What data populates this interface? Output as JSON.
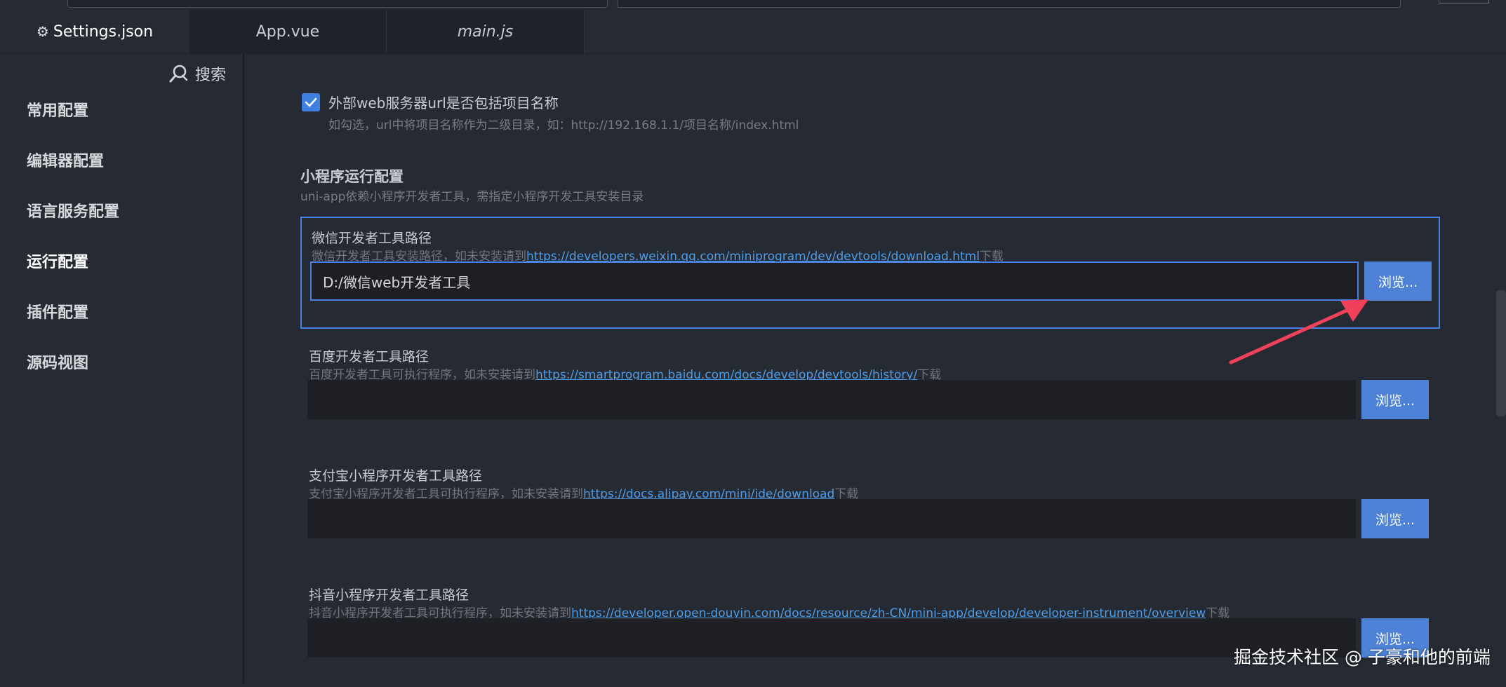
{
  "tabs": [
    {
      "label": "Settings.json",
      "icon": "gear-icon",
      "active": true
    },
    {
      "label": "App.vue",
      "active": false
    },
    {
      "label": "main.js",
      "active": false
    }
  ],
  "sidebar": {
    "search_label": "搜索",
    "items": [
      {
        "label": "常用配置"
      },
      {
        "label": "编辑器配置"
      },
      {
        "label": "语言服务配置"
      },
      {
        "label": "运行配置",
        "active": true
      },
      {
        "label": "插件配置"
      },
      {
        "label": "源码视图"
      }
    ]
  },
  "settings": {
    "checkbox": {
      "label": "外部web服务器url是否包括项目名称",
      "desc": "如勾选，url中将项目名称作为二级目录，如：http://192.168.1.1/项目名称/index.html",
      "checked": true
    },
    "section": {
      "title": "小程序运行配置",
      "desc": "uni-app依赖小程序开发者工具，需指定小程序开发工具安装目录"
    },
    "groups": [
      {
        "label": "微信开发者工具路径",
        "desc_prefix": "微信开发者工具安装路径，如未安装请到",
        "link": "https://developers.weixin.qq.com/miniprogram/dev/devtools/download.html",
        "desc_suffix": "下载",
        "value": "D:/微信web开发者工具",
        "browse": "浏览..."
      },
      {
        "label": "百度开发者工具路径",
        "desc_prefix": "百度开发者工具可执行程序，如未安装请到",
        "link": "https://smartprogram.baidu.com/docs/develop/devtools/history/",
        "desc_suffix": "下载",
        "value": "",
        "browse": "浏览..."
      },
      {
        "label": "支付宝小程序开发者工具路径",
        "desc_prefix": "支付宝小程序开发者工具可执行程序，如未安装请到",
        "link": "https://docs.alipay.com/mini/ide/download",
        "desc_suffix": "下载",
        "value": "",
        "browse": "浏览..."
      },
      {
        "label": "抖音小程序开发者工具路径",
        "desc_prefix": "抖音小程序开发者工具可执行程序，如未安装请到",
        "link": "https://developer.open-douyin.com/docs/resource/zh-CN/mini-app/develop/developer-instrument/overview",
        "desc_suffix": "下载",
        "value": "",
        "browse": "浏览..."
      }
    ]
  },
  "watermark": "掘金技术社区 @ 子豪和他的前端",
  "colors": {
    "accent": "#4a7fe2",
    "button": "#4e82d6",
    "link": "#4f9de8",
    "arrow": "#f0405a"
  }
}
